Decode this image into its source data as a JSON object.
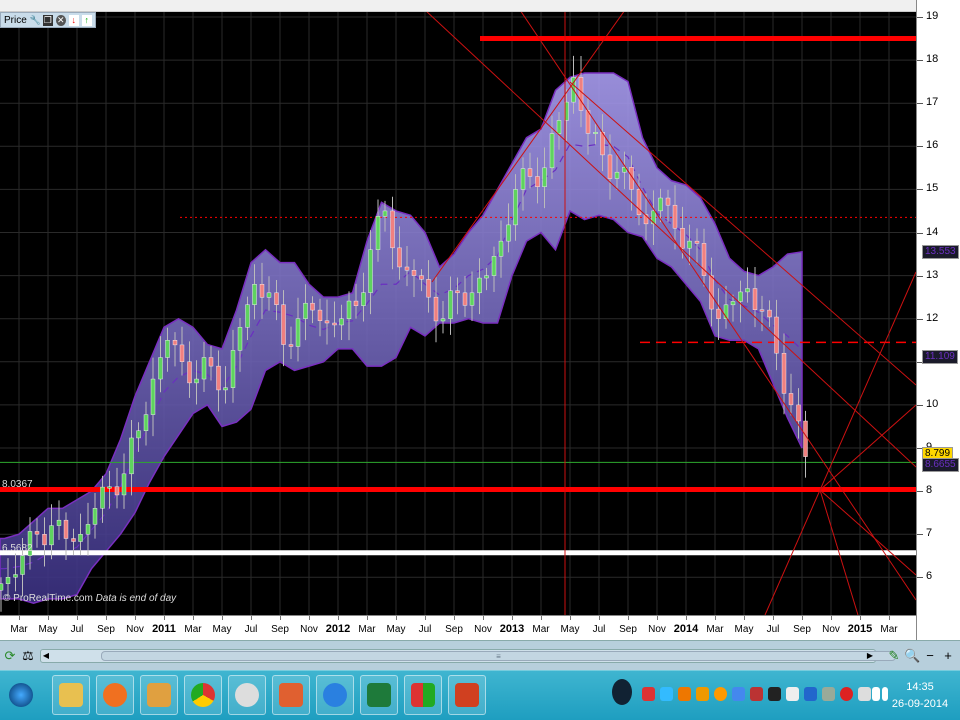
{
  "toolbar_price": {
    "label": "Price",
    "icons": [
      "wrench-icon",
      "copy-icon",
      "close-icon",
      "move-down-icon",
      "move-up-icon"
    ]
  },
  "y_axis": {
    "ticks": [
      "19",
      "18",
      "17",
      "16",
      "15",
      "14",
      "13",
      "12",
      "11",
      "10",
      "9",
      "8",
      "7",
      "6"
    ],
    "price_tags": [
      {
        "value": "13.553",
        "bg": "#1a1a2a",
        "fg": "#6a2fc0",
        "level": 13.553
      },
      {
        "value": "11.109",
        "bg": "#1a1a2a",
        "fg": "#6a2fc0",
        "level": 11.109
      },
      {
        "value": "8.799",
        "bg": "#ffd800",
        "fg": "#000",
        "level": 8.85
      },
      {
        "value": "8.6655",
        "bg": "#1a1a2a",
        "fg": "#6a2fc0",
        "level": 8.6
      }
    ]
  },
  "x_axis": {
    "labels": [
      "Mar",
      "May",
      "Jul",
      "Sep",
      "Nov",
      "2011",
      "Mar",
      "May",
      "Jul",
      "Sep",
      "Nov",
      "2012",
      "Mar",
      "May",
      "Jul",
      "Sep",
      "Nov",
      "2013",
      "Mar",
      "May",
      "Jul",
      "Sep",
      "Nov",
      "2014",
      "Mar",
      "May",
      "Jul",
      "Sep",
      "Nov",
      "2015",
      "Mar"
    ]
  },
  "levels": {
    "red_label": "8.0367",
    "white_label": "6.5682"
  },
  "footer": {
    "copyright": "© ProRealTime.com",
    "note": "Data is end of day"
  },
  "clock": {
    "time": "14:35",
    "date": "26-09-2014"
  },
  "colors": {
    "up": "#5fd35f",
    "down": "#f08080",
    "band_border": "#7a2fc0",
    "band_fill_top": "#a89cf0",
    "band_fill_bottom": "#4a3f90",
    "level_red": "#ff0000",
    "level_white": "#ffffff",
    "level_green": "#2eaa2e"
  },
  "chart_data": {
    "type": "candlestick",
    "title": "Price",
    "start_month": "2010-02",
    "ylim": [
      5.2,
      19.1
    ],
    "closes": [
      6.0,
      6.5,
      7.0,
      7.2,
      6.9,
      7.0,
      7.6,
      8.1,
      8.4,
      9.4,
      10.6,
      11.5,
      11.0,
      10.6,
      10.9,
      10.4,
      11.8,
      12.8,
      12.6,
      11.4,
      12.0,
      12.2,
      11.9,
      12.0,
      12.3,
      13.6,
      14.5,
      13.2,
      13.0,
      12.5,
      12.0,
      12.6,
      12.6,
      13.0,
      13.8,
      15.0,
      15.3,
      15.5,
      16.6,
      17.6,
      16.3,
      15.8,
      15.4,
      15.0,
      14.2,
      14.8,
      14.1,
      13.8,
      13.0,
      12.0,
      12.4,
      12.7,
      12.2,
      11.2,
      10.0,
      8.8
    ],
    "bollinger_upper": [
      6.9,
      7.0,
      7.3,
      7.6,
      7.6,
      7.8,
      8.0,
      8.4,
      9.2,
      10.2,
      11.0,
      11.8,
      12.0,
      11.8,
      11.4,
      11.3,
      12.2,
      13.3,
      13.6,
      13.3,
      13.3,
      12.8,
      12.5,
      12.5,
      12.6,
      13.8,
      14.7,
      14.5,
      14.4,
      14.0,
      13.2,
      13.5,
      14.0,
      14.4,
      15.0,
      15.6,
      16.2,
      16.4,
      17.3,
      17.6,
      17.7,
      17.7,
      17.7,
      17.5,
      16.2,
      15.5,
      15.2,
      15.1,
      14.8,
      14.2,
      13.4,
      13.1,
      13.0,
      13.2,
      13.5,
      13.55
    ],
    "bollinger_lower": [
      5.5,
      5.5,
      5.4,
      5.5,
      5.5,
      5.6,
      6.2,
      6.6,
      7.0,
      7.5,
      8.2,
      8.8,
      9.3,
      9.8,
      10.0,
      9.5,
      9.6,
      9.9,
      10.8,
      11.0,
      10.8,
      10.9,
      11.0,
      11.3,
      11.3,
      10.9,
      10.9,
      11.1,
      11.8,
      11.6,
      11.9,
      11.9,
      12.0,
      11.9,
      11.9,
      13.0,
      13.8,
      14.0,
      13.6,
      14.5,
      14.3,
      14.4,
      14.3,
      14.0,
      13.9,
      13.4,
      13.2,
      12.8,
      12.4,
      11.6,
      11.5,
      11.5,
      11.3,
      10.5,
      9.7,
      9.0
    ],
    "horizontal_levels": [
      {
        "value": 18.5,
        "style": "solid-thick",
        "color": "red"
      },
      {
        "value": 14.35,
        "style": "dotted",
        "color": "red"
      },
      {
        "value": 11.45,
        "style": "dashed",
        "color": "red"
      },
      {
        "value": 8.6655,
        "style": "thin",
        "color": "green"
      },
      {
        "value": 8.0367,
        "style": "solid-thick",
        "color": "red"
      },
      {
        "value": 6.5682,
        "style": "solid-thick",
        "color": "white"
      }
    ]
  }
}
